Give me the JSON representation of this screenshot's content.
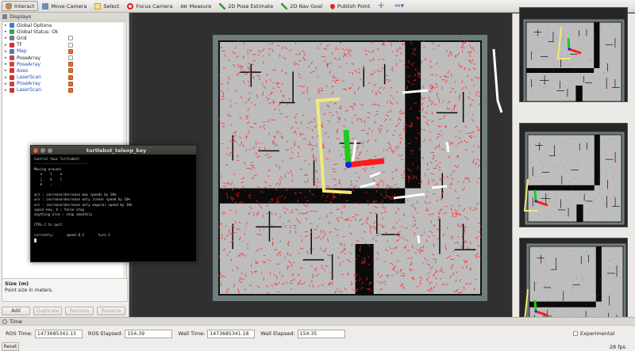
{
  "toolbar": {
    "tools": [
      {
        "label": "Interact",
        "icon": "hand-icon",
        "active": true
      },
      {
        "label": "Move Camera",
        "icon": "camera-icon"
      },
      {
        "label": "Select",
        "icon": "select-icon"
      },
      {
        "label": "Focus Camera",
        "icon": "focus-icon"
      },
      {
        "label": "Measure",
        "icon": "measure-icon"
      },
      {
        "label": "2D Pose Estimate",
        "icon": "pose-arrow-icon"
      },
      {
        "label": "2D Nav Goal",
        "icon": "goal-arrow-icon"
      },
      {
        "label": "Publish Point",
        "icon": "point-pin-icon"
      }
    ],
    "extra_icons": [
      "plus-icon",
      "minus-icon"
    ]
  },
  "displays": {
    "title": "Displays",
    "items": [
      {
        "label": "Global Options",
        "color": "#3a7bd5",
        "blue": false,
        "checkbox": null
      },
      {
        "label": "Global Status: Ok",
        "color": "#2fa84f",
        "blue": false,
        "checkbox": null
      },
      {
        "label": "Grid",
        "color": "#777777",
        "blue": false,
        "checkbox": false
      },
      {
        "label": "TF",
        "color": "#cc3333",
        "blue": false,
        "checkbox": false
      },
      {
        "label": "Map",
        "color": "#5577aa",
        "blue": true,
        "checkbox": true
      },
      {
        "label": "PoseArray",
        "color": "#cc4444",
        "blue": false,
        "checkbox": false
      },
      {
        "label": "PoseArray",
        "color": "#cc4444",
        "blue": true,
        "checkbox": true
      },
      {
        "label": "Axes",
        "color": "#cc3333",
        "blue": true,
        "checkbox": true
      },
      {
        "label": "LaserScan",
        "color": "#cc3333",
        "blue": true,
        "checkbox": true
      },
      {
        "label": "PoseArray",
        "color": "#cc4444",
        "blue": true,
        "checkbox": true
      },
      {
        "label": "LaserScan",
        "color": "#cc3333",
        "blue": true,
        "checkbox": true
      }
    ],
    "description": {
      "title": "Size (m)",
      "text": "Point size in meters."
    },
    "buttons": [
      {
        "label": "Add",
        "enabled": true
      },
      {
        "label": "Duplicate",
        "enabled": false
      },
      {
        "label": "Remove",
        "enabled": false
      },
      {
        "label": "Rename",
        "enabled": false
      }
    ]
  },
  "terminal": {
    "title": "turtlebot_teleop_key",
    "lines": [
      "Control Your Turtlebot!",
      "---------------------------",
      "Moving around:",
      "   u    i    o",
      "   j    k    l",
      "   m    ,    .",
      "",
      "q/z : increase/decrease max speeds by 10%",
      "w/x : increase/decrease only linear speed by 10%",
      "e/c : increase/decrease only angular speed by 10%",
      "space key, k : force stop",
      "anything else : stop smoothly",
      "",
      "CTRL-C to quit",
      "",
      "currently:      speed 0.2       turn 1"
    ]
  },
  "time": {
    "title": "Time",
    "ros_time_label": "ROS Time:",
    "ros_time": "1473685341.15",
    "ros_elapsed_label": "ROS Elapsed:",
    "ros_elapsed": "154.39",
    "wall_time_label": "Wall Time:",
    "wall_time": "1473685341.18",
    "wall_elapsed_label": "Wall Elapsed:",
    "wall_elapsed": "154.35",
    "experimental_label": "Experimental",
    "reset_label": "Reset",
    "fps": "28 fps"
  },
  "colors": {
    "particles": "#ff2020",
    "path": "#f4e87a",
    "axis_x": "#ff1a1a",
    "axis_y": "#1acc1a",
    "axis_z": "#1a1aff",
    "map_free": "#bdbdbd",
    "map_unknown": "#6e7d7d"
  }
}
